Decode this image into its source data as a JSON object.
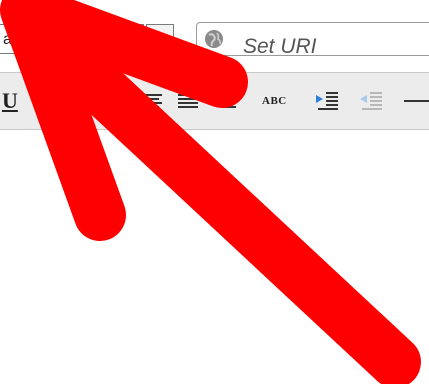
{
  "font_field": {
    "value": "ar"
  },
  "url_field": {
    "placeholder": "Set URI",
    "icon": "globe-icon"
  },
  "toolbar": {
    "underline_label": "U",
    "spellcheck_label": "ABC",
    "icons": [
      "underline-icon",
      "align-center-icon",
      "align-justify-icon",
      "align-right-icon",
      "spellcheck-icon",
      "indent-icon",
      "outdent-icon",
      "horizontal-rule-icon"
    ]
  },
  "annotation": {
    "arrow_color": "#ff0000"
  }
}
